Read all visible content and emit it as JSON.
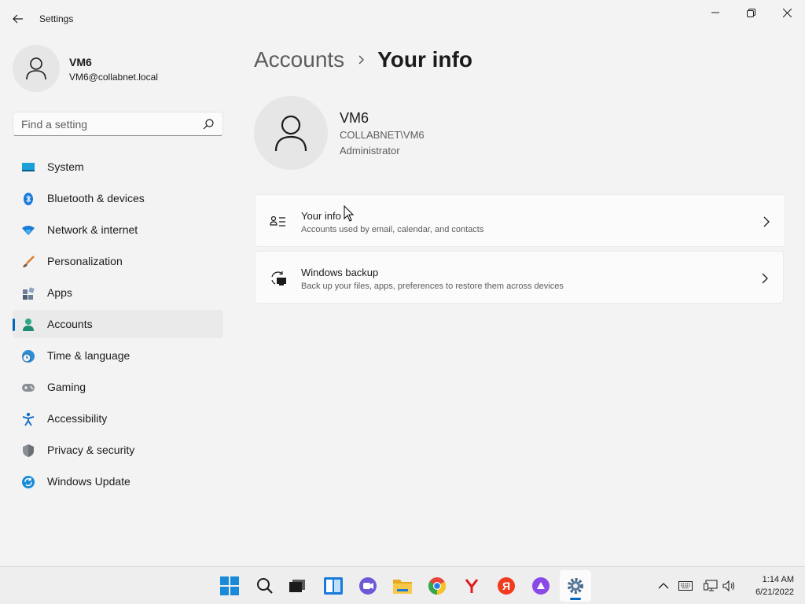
{
  "window": {
    "title": "Settings"
  },
  "profile": {
    "name": "VM6",
    "email": "VM6@collabnet.local"
  },
  "search": {
    "placeholder": "Find a setting"
  },
  "nav": {
    "items": [
      {
        "label": "System",
        "icon": "monitor-icon"
      },
      {
        "label": "Bluetooth & devices",
        "icon": "bluetooth-icon"
      },
      {
        "label": "Network & internet",
        "icon": "wifi-icon"
      },
      {
        "label": "Personalization",
        "icon": "brush-icon"
      },
      {
        "label": "Apps",
        "icon": "apps-icon"
      },
      {
        "label": "Accounts",
        "icon": "person-icon",
        "active": true
      },
      {
        "label": "Time & language",
        "icon": "clock-globe-icon"
      },
      {
        "label": "Gaming",
        "icon": "gamepad-icon"
      },
      {
        "label": "Accessibility",
        "icon": "accessibility-icon"
      },
      {
        "label": "Privacy & security",
        "icon": "shield-icon"
      },
      {
        "label": "Windows Update",
        "icon": "update-icon"
      }
    ]
  },
  "breadcrumb": {
    "parent": "Accounts",
    "current": "Your info"
  },
  "user": {
    "name": "VM6",
    "domain": "COLLABNET\\VM6",
    "role": "Administrator"
  },
  "cards": [
    {
      "title": "Your info",
      "subtitle": "Accounts used by email, calendar, and contacts",
      "icon": "contact-card-icon"
    },
    {
      "title": "Windows backup",
      "subtitle": "Back up your files, apps, preferences to restore them across devices",
      "icon": "backup-sync-icon"
    }
  ],
  "taskbar": {
    "apps": [
      "start",
      "search",
      "task-view",
      "widgets",
      "chat",
      "file-explorer",
      "chrome",
      "yandex-browser",
      "yandex",
      "alice",
      "settings"
    ],
    "clock": {
      "time": "1:14 AM",
      "date": "6/21/2022"
    }
  },
  "colors": {
    "accent": "#0067c0",
    "background": "#f3f3f3",
    "card": "#fbfbfb"
  }
}
